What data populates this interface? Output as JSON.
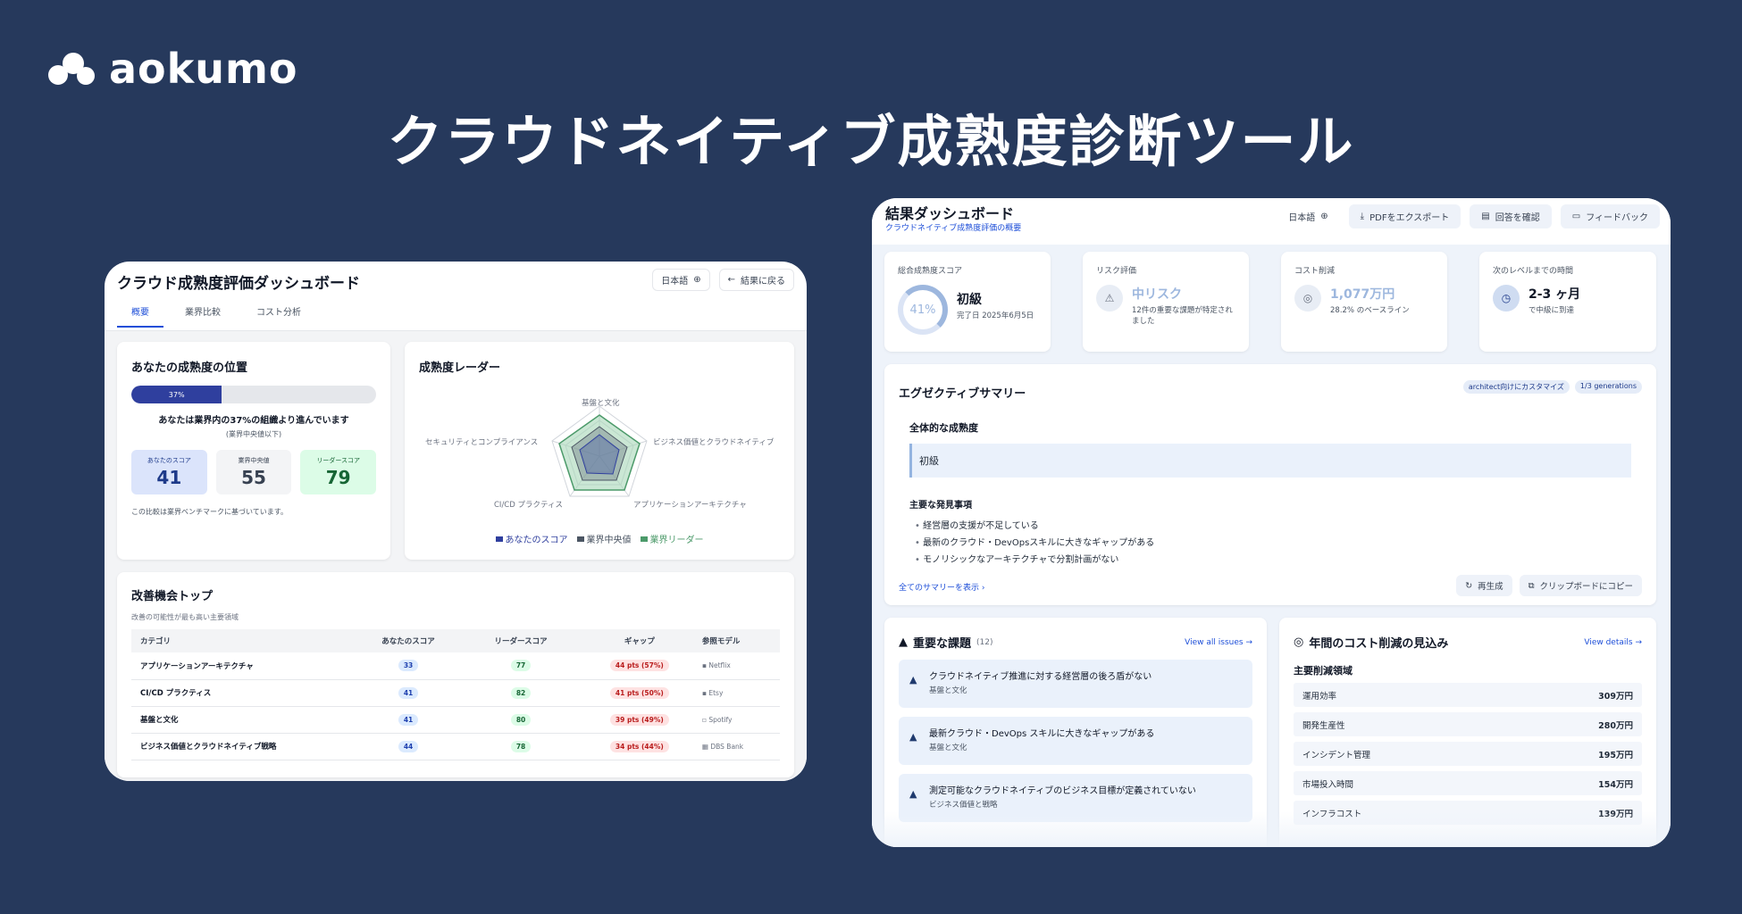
{
  "brand": {
    "name": "aokumo"
  },
  "hero_title": "クラウドネイティブ成熟度診断ツール",
  "left": {
    "title": "クラウド成熟度評価ダッシュボード",
    "lang_btn": "日本語",
    "back_btn": "結果に戻る",
    "tabs": [
      "概要",
      "業界比較",
      "コスト分析"
    ],
    "position": {
      "title": "あなたの成熟度の位置",
      "percent_label": "37%",
      "percent": 37,
      "main": "あなたは業界内の37%の組織より進んでいます",
      "sub": "(業界中央値以下)",
      "scores": [
        {
          "label": "あなたのスコア",
          "value": "41"
        },
        {
          "label": "業界中央値",
          "value": "55"
        },
        {
          "label": "リーダースコア",
          "value": "79"
        }
      ],
      "note": "この比較は業界ベンチマークに基づいています。"
    },
    "radar": {
      "title": "成熟度レーダー",
      "axes": [
        "基盤と文化",
        "ビジネス価値とクラウドネイティブ",
        "アプリケーションアーキテクチャ",
        "CI/CD プラクティス",
        "セキュリティとコンプライアンス"
      ],
      "legend": [
        "あなたのスコア",
        "業界中央値",
        "業界リーダー"
      ]
    },
    "improvements": {
      "title": "改善機会トップ",
      "subtitle": "改善の可能性が最も高い主要領域",
      "headers": [
        "カテゴリ",
        "あなたのスコア",
        "リーダースコア",
        "ギャップ",
        "参照モデル"
      ],
      "rows": [
        {
          "category": "アプリケーションアーキテクチャ",
          "you": "33",
          "leader": "77",
          "gap": "44 pts (57%)",
          "ref": "Netflix"
        },
        {
          "category": "CI/CD プラクティス",
          "you": "41",
          "leader": "82",
          "gap": "41 pts (50%)",
          "ref": "Etsy"
        },
        {
          "category": "基盤と文化",
          "you": "41",
          "leader": "80",
          "gap": "39 pts (49%)",
          "ref": "Spotify"
        },
        {
          "category": "ビジネス価値とクラウドネイティブ戦略",
          "you": "44",
          "leader": "78",
          "gap": "34 pts (44%)",
          "ref": "DBS Bank"
        }
      ]
    }
  },
  "right": {
    "title": "結果ダッシュボード",
    "subtitle": "クラウドネイティブ成熟度評価の概要",
    "actions": {
      "lang": "日本語",
      "export": "PDFをエクスポート",
      "review": "回答を確認",
      "feedback": "フィードバック"
    },
    "kpis": {
      "maturity": {
        "label": "総合成熟度スコア",
        "ring": "41%",
        "value": "初級",
        "sub": "完了日 2025年6月5日"
      },
      "risk": {
        "label": "リスク評価",
        "value": "中リスク",
        "sub": "12件の重要な課題が特定されました"
      },
      "cost": {
        "label": "コスト削減",
        "value": "1,077万円",
        "sub": "28.2% のベースライン"
      },
      "time": {
        "label": "次のレベルまでの時間",
        "value": "2-3 ヶ月",
        "sub": "で中級に到達"
      }
    },
    "summary": {
      "title": "エグゼクティブサマリー",
      "tags": [
        "architect向けにカスタマイズ",
        "1/3 generations"
      ],
      "overall_h": "全体的な成熟度",
      "overall_v": "初級",
      "findings_h": "主要な発見事項",
      "findings": [
        "経営層の支援が不足している",
        "最新のクラウド・DevOpsスキルに大きなギャップがある",
        "モノリシックなアーキテクチャで分割計画がない"
      ],
      "show_all": "全てのサマリーを表示",
      "regen": "再生成",
      "copy": "クリップボードにコピー"
    },
    "issues": {
      "title": "重要な課題",
      "count": "(12)",
      "link": "View all issues",
      "items": [
        {
          "title": "クラウドネイティブ推進に対する経営層の後ろ盾がない",
          "cat": "基盤と文化"
        },
        {
          "title": "最新クラウド・DevOps スキルに大きなギャップがある",
          "cat": "基盤と文化"
        },
        {
          "title": "測定可能なクラウドネイティブのビジネス目標が定義されていない",
          "cat": "ビジネス価値と戦略"
        }
      ]
    },
    "costs": {
      "title": "年間のコスト削減の見込み",
      "link": "View details",
      "heading": "主要削減領域",
      "items": [
        {
          "label": "運用効率",
          "value": "309万円"
        },
        {
          "label": "開発生産性",
          "value": "280万円"
        },
        {
          "label": "インシデント管理",
          "value": "195万円"
        },
        {
          "label": "市場投入時間",
          "value": "154万円"
        },
        {
          "label": "インフラコスト",
          "value": "139万円"
        }
      ]
    }
  }
}
